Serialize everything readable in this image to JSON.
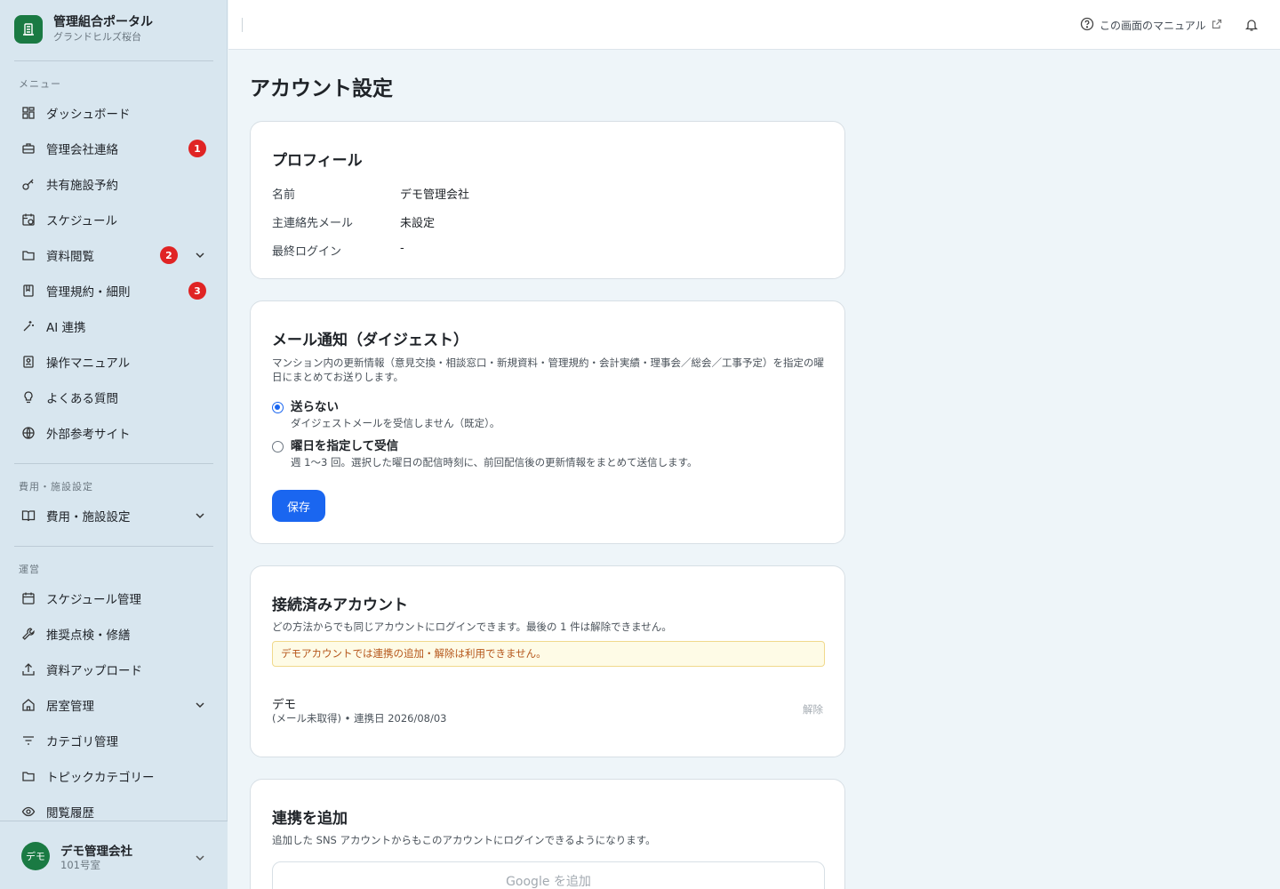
{
  "brand": {
    "title": "管理組合ポータル",
    "subtitle": "グランドヒルズ桜台",
    "icon": "building-icon"
  },
  "sidebar": {
    "menu_label": "メニュー",
    "menu": [
      {
        "label": "ダッシュボード",
        "icon": "dashboard-icon"
      },
      {
        "label": "管理会社連絡",
        "icon": "briefcase-icon",
        "badge": "1"
      },
      {
        "label": "共有施設予約",
        "icon": "key-icon"
      },
      {
        "label": "スケジュール",
        "icon": "calendar-clock-icon"
      },
      {
        "label": "資料閲覧",
        "icon": "folder-icon",
        "badge": "2",
        "expandable": true
      },
      {
        "label": "管理規約・細則",
        "icon": "book-icon",
        "badge": "3"
      },
      {
        "label": "AI 連携",
        "icon": "sparkle-icon"
      },
      {
        "label": "操作マニュアル",
        "icon": "manual-icon"
      },
      {
        "label": "よくある質問",
        "icon": "lightbulb-icon"
      },
      {
        "label": "外部参考サイト",
        "icon": "globe-icon"
      }
    ],
    "fees_label": "費用・施設設定",
    "fees": [
      {
        "label": "費用・施設設定",
        "icon": "open-book-icon",
        "expandable": true
      }
    ],
    "ops_label": "運営",
    "ops": [
      {
        "label": "スケジュール管理",
        "icon": "calendar-icon"
      },
      {
        "label": "推奨点検・修繕",
        "icon": "wrench-icon"
      },
      {
        "label": "資料アップロード",
        "icon": "upload-icon"
      },
      {
        "label": "居室管理",
        "icon": "home-icon",
        "expandable": true
      },
      {
        "label": "カテゴリ管理",
        "icon": "filter-icon"
      },
      {
        "label": "トピックカテゴリー",
        "icon": "folder-icon"
      },
      {
        "label": "閲覧履歴",
        "icon": "eye-icon"
      }
    ],
    "user": {
      "avatar": "デモ",
      "name": "デモ管理会社",
      "room": "101号室"
    }
  },
  "topbar": {
    "manual_link": "この画面のマニュアル"
  },
  "page": {
    "title": "アカウント設定"
  },
  "profile": {
    "title": "プロフィール",
    "rows": [
      {
        "key": "名前",
        "value": "デモ管理会社"
      },
      {
        "key": "主連絡先メール",
        "value": "未設定"
      },
      {
        "key": "最終ログイン",
        "value": "-"
      }
    ]
  },
  "digest": {
    "title": "メール通知（ダイジェスト）",
    "description": "マンション内の更新情報（意見交換・相談窓口・新規資料・管理規約・会計実績・理事会／総会／工事予定）を指定の曜日にまとめてお送りします。",
    "options": [
      {
        "label": "送らない",
        "desc": "ダイジェストメールを受信しません（既定）。",
        "checked": true
      },
      {
        "label": "曜日を指定して受信",
        "desc": "週 1〜3 回。選択した曜日の配信時刻に、前回配信後の更新情報をまとめて送信します。",
        "checked": false
      }
    ],
    "save_label": "保存"
  },
  "connected": {
    "title": "接続済みアカウント",
    "description": "どの方法からでも同じアカウントにログインできます。最後の 1 件は解除できません。",
    "notice": "デモアカウントでは連携の追加・解除は利用できません。",
    "account_name": "デモ",
    "account_meta": "(メール未取得) • 連携日 2026/08/03",
    "unlink_label": "解除"
  },
  "add_link": {
    "title": "連携を追加",
    "description": "追加した SNS アカウントからもこのアカウントにログインできるようになります。",
    "google_label": "Google を追加"
  },
  "colors": {
    "accent": "#1a66f0",
    "brand": "#1a7a43",
    "badge": "#e02424"
  }
}
